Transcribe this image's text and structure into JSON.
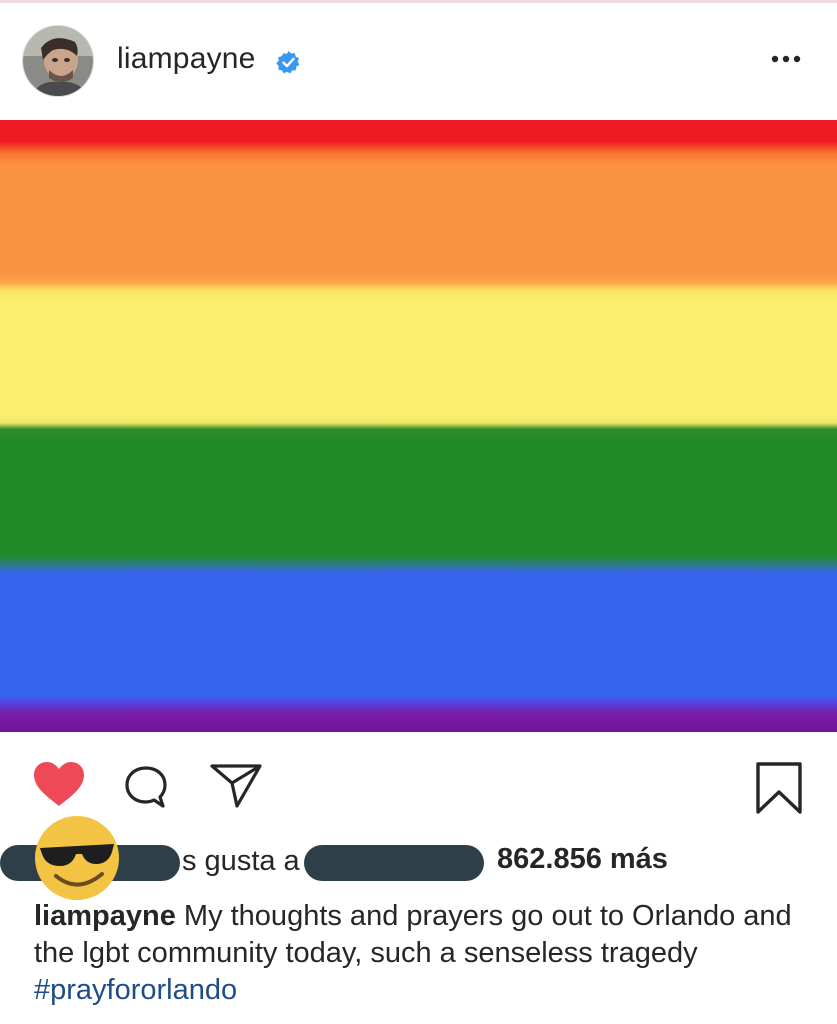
{
  "post": {
    "author": "liampayne",
    "verified": true,
    "flag_colors": [
      "#ef1b24",
      "#fb9442",
      "#fbee70",
      "#1f8a26",
      "#3764ef",
      "#6f1399"
    ]
  },
  "icons": {
    "more": "more-horizontal-icon",
    "like": "heart-filled-icon",
    "comment": "comment-bubble-icon",
    "share": "paper-plane-icon",
    "save": "bookmark-icon",
    "verified": "verified-badge-icon",
    "emoji": "sunglasses-emoji-icon"
  },
  "likes": {
    "text_fragment_1": "s gusta a",
    "count_text": "862.856 más"
  },
  "caption": {
    "username": "liampayne",
    "body": "My thoughts and prayers go out to Orlando and the lgbt community today, such a senseless tragedy ",
    "hashtag": "#prayfororlando"
  },
  "colors": {
    "like_red": "#ed4956",
    "redaction": "#2f3f49",
    "verified_blue": "#3897f0",
    "hashtag_blue": "#1f4d8a"
  }
}
